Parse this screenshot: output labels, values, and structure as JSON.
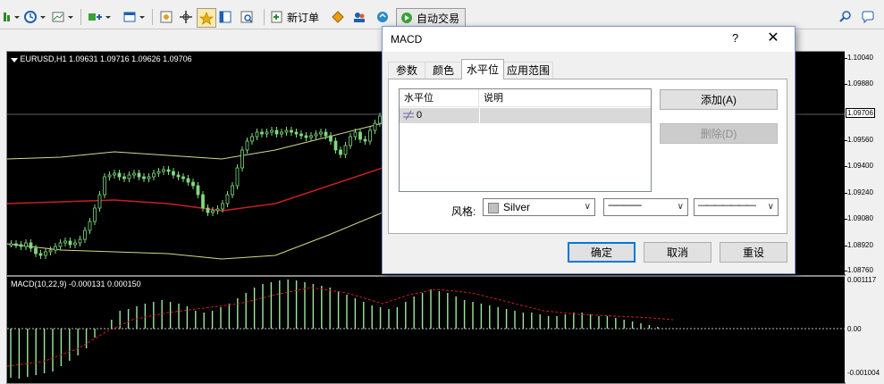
{
  "toolbar": {
    "new_order_label": "新订单",
    "auto_trade_label": "自动交易"
  },
  "price_pane": {
    "title": "EURUSD,H1  1.09631 1.09716 1.09626 1.09706",
    "axis_labels": [
      "1.10040",
      "1.09880",
      "1.09706",
      "1.09560",
      "1.09400",
      "1.09240",
      "1.09080",
      "1.08920",
      "1.08760"
    ],
    "current_price": "1.09706"
  },
  "macd_pane": {
    "title": "MACD(10,22,9) -0.000131 0.000150",
    "axis_labels": [
      "0.001117",
      "0.00",
      "-0.001004"
    ]
  },
  "dialog": {
    "title": "MACD",
    "help": "?",
    "close": "✕",
    "tabs": [
      "参数",
      "颜色",
      "水平位",
      "应用范围"
    ],
    "active_tab": "水平位",
    "levels": {
      "headers": [
        "水平位",
        "说明"
      ],
      "rows": [
        {
          "value": "0",
          "description": ""
        }
      ]
    },
    "add_button": "添加(A)",
    "delete_button": "删除(D)",
    "style_label": "风格:",
    "color_value": "Silver",
    "line_style_value": "--------------",
    "line_width_value": "———————",
    "ok_button": "确定",
    "cancel_button": "取消",
    "reset_button": "重设"
  },
  "colors": {
    "chart_bg": "#000000",
    "bull_candle": "#7fd97f",
    "envelope_upper": "#d7d78a",
    "envelope_mid": "#c81f1f",
    "macd_hist": "#9fe89f",
    "macd_signal": "#c81f1f",
    "level_line": "#c0c0c0"
  }
}
